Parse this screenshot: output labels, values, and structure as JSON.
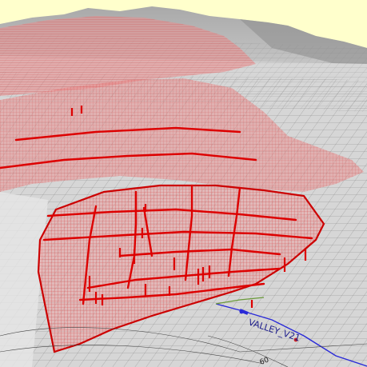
{
  "map": {
    "road_labels": [
      {
        "text": "VALLEY_V21"
      }
    ],
    "contour_labels": [
      {
        "text": "60"
      }
    ],
    "colors": {
      "sky": "#ffffcc",
      "terrain_light": "#d9d9d9",
      "terrain_mid": "#bdbdbd",
      "terrain_dark": "#8e8e8e",
      "parcel_line": "#6f6f6f",
      "overlay_fill": "#e98c8c",
      "overlay_line": "#cc0000",
      "network_pipe": "#dd0000",
      "road_line": "#2a2ad8",
      "green_feature": "#6a9a3a"
    }
  }
}
